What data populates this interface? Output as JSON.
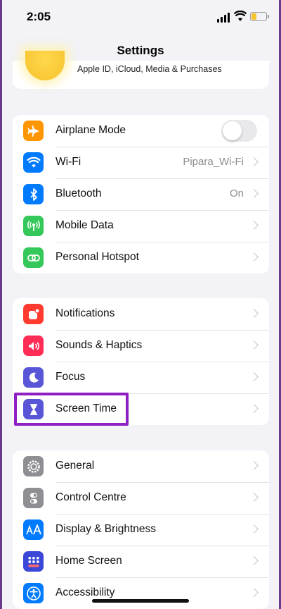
{
  "status_bar": {
    "time": "2:05"
  },
  "nav": {
    "title": "Settings"
  },
  "profile": {
    "subtitle": "Apple ID, iCloud, Media & Purchases"
  },
  "group1": [
    {
      "label": "Airplane Mode",
      "icon": "airplane-icon",
      "color": "#ff9500",
      "control": "toggle",
      "toggle_on": false
    },
    {
      "label": "Wi-Fi",
      "icon": "wifi-icon",
      "color": "#007aff",
      "value": "Pipara_Wi-Fi"
    },
    {
      "label": "Bluetooth",
      "icon": "bluetooth-icon",
      "color": "#007aff",
      "value": "On"
    },
    {
      "label": "Mobile Data",
      "icon": "antenna-icon",
      "color": "#34c759"
    },
    {
      "label": "Personal Hotspot",
      "icon": "hotspot-icon",
      "color": "#34c759"
    }
  ],
  "group2": [
    {
      "label": "Notifications",
      "icon": "notifications-icon",
      "color": "#ff3b30"
    },
    {
      "label": "Sounds & Haptics",
      "icon": "speaker-icon",
      "color": "#ff2d55"
    },
    {
      "label": "Focus",
      "icon": "moon-icon",
      "color": "#5856d6"
    },
    {
      "label": "Screen Time",
      "icon": "hourglass-icon",
      "color": "#5856d6"
    }
  ],
  "group3": [
    {
      "label": "General",
      "icon": "gear-icon",
      "color": "#8e8e93"
    },
    {
      "label": "Control Centre",
      "icon": "switches-icon",
      "color": "#8e8e93"
    },
    {
      "label": "Display & Brightness",
      "icon": "text-size-icon",
      "color": "#007aff"
    },
    {
      "label": "Home Screen",
      "icon": "home-screen-icon",
      "color": "#3b47d6"
    },
    {
      "label": "Accessibility",
      "icon": "accessibility-icon",
      "color": "#007aff"
    }
  ],
  "highlight_color": "#8f1fc2"
}
